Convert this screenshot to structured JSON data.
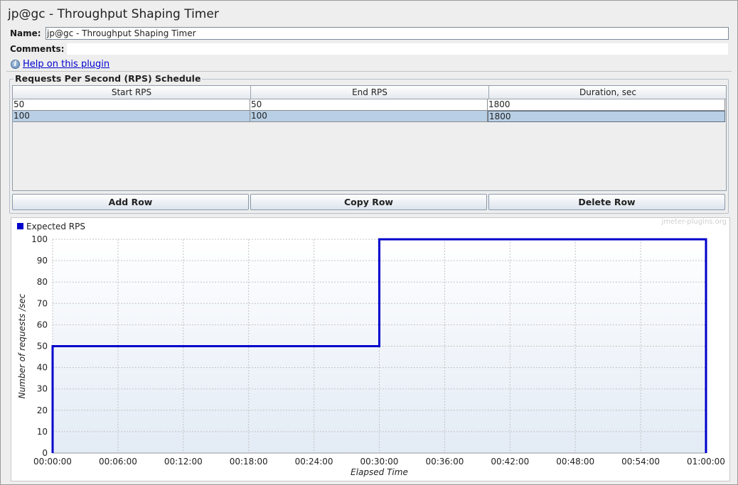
{
  "window": {
    "title": "jp@gc - Throughput Shaping Timer"
  },
  "form": {
    "name_label": "Name:",
    "name_value": "jp@gc - Throughput Shaping Timer",
    "comments_label": "Comments:",
    "comments_value": "",
    "help_link": "Help on this plugin"
  },
  "schedule": {
    "title": "Requests Per Second (RPS) Schedule",
    "columns": [
      "Start RPS",
      "End RPS",
      "Duration, sec"
    ],
    "rows": [
      [
        "50",
        "50",
        "1800"
      ],
      [
        "100",
        "100",
        "1800"
      ]
    ],
    "selected_row": 1
  },
  "buttons": {
    "add_row": "Add Row",
    "copy_row": "Copy Row",
    "delete_row": "Delete Row"
  },
  "chart_watermark": "jmeter-plugins.org",
  "chart_data": {
    "type": "line",
    "series": [
      {
        "name": "Expected RPS",
        "color": "#0000cc",
        "points": [
          [
            "00:00:00",
            0
          ],
          [
            "00:00:00",
            50
          ],
          [
            "00:30:00",
            50
          ],
          [
            "00:30:00",
            100
          ],
          [
            "01:00:00",
            100
          ],
          [
            "01:00:00",
            0
          ]
        ]
      }
    ],
    "x_ticks": [
      "00:00:00",
      "00:06:00",
      "00:12:00",
      "00:18:00",
      "00:24:00",
      "00:30:00",
      "00:36:00",
      "00:42:00",
      "00:48:00",
      "00:54:00",
      "01:00:00"
    ],
    "y_ticks": [
      0,
      10,
      20,
      30,
      40,
      50,
      60,
      70,
      80,
      90,
      100
    ],
    "xlabel": "Elapsed Time",
    "ylabel": "Number of requests /sec",
    "xlim": [
      "00:00:00",
      "01:00:00"
    ],
    "ylim": [
      0,
      100
    ],
    "grid": true,
    "legend_position": "top-left"
  }
}
